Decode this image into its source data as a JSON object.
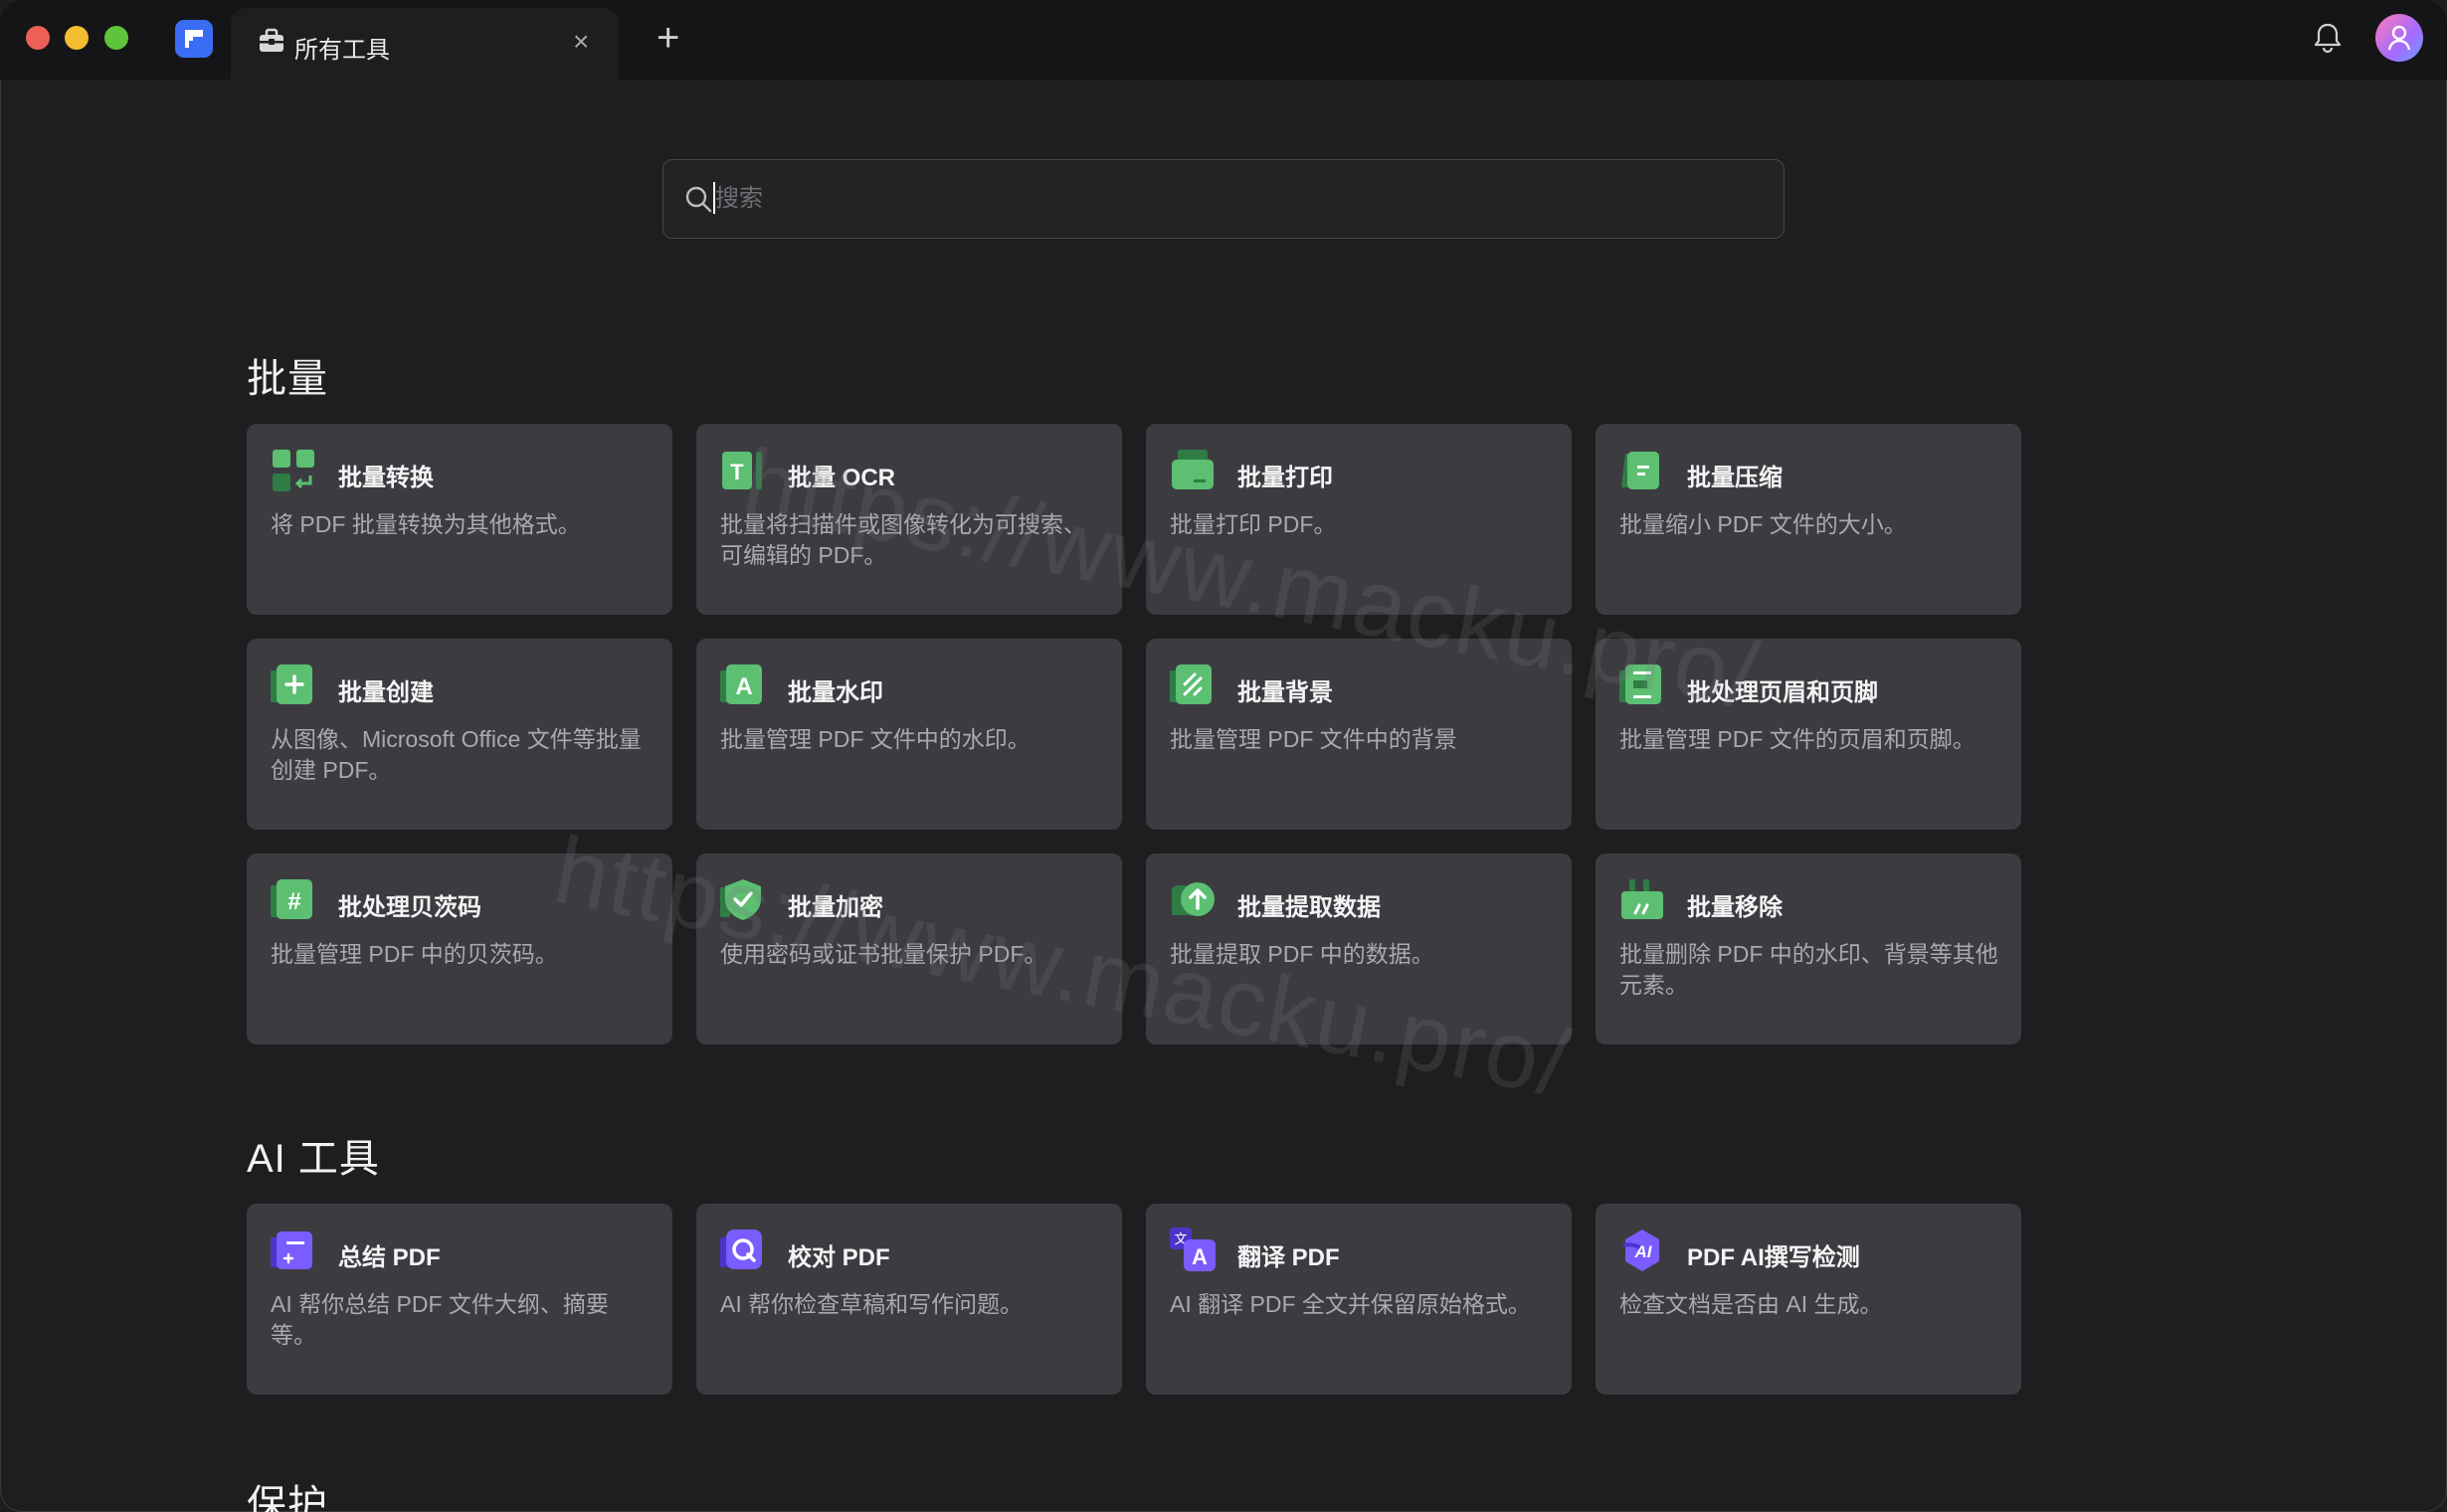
{
  "titlebar": {
    "tab_label": "所有工具",
    "tab_close": "×",
    "new_tab": "+"
  },
  "search": {
    "placeholder": "搜索",
    "value": ""
  },
  "sections": [
    {
      "title": "批量",
      "cards": [
        {
          "title": "批量转换",
          "desc": "将 PDF 批量转换为其他格式。",
          "icon": "batch-convert-icon"
        },
        {
          "title": "批量 OCR",
          "desc": "批量将扫描件或图像转化为可搜索、可编辑的 PDF。",
          "icon": "batch-ocr-icon"
        },
        {
          "title": "批量打印",
          "desc": "批量打印 PDF。",
          "icon": "batch-print-icon"
        },
        {
          "title": "批量压缩",
          "desc": "批量缩小 PDF 文件的大小。",
          "icon": "batch-compress-icon"
        },
        {
          "title": "批量创建",
          "desc": "从图像、Microsoft Office 文件等批量创建 PDF。",
          "icon": "batch-create-icon"
        },
        {
          "title": "批量水印",
          "desc": "批量管理 PDF 文件中的水印。",
          "icon": "batch-watermark-icon"
        },
        {
          "title": "批量背景",
          "desc": "批量管理 PDF 文件中的背景",
          "icon": "batch-background-icon"
        },
        {
          "title": "批处理页眉和页脚",
          "desc": "批量管理 PDF 文件的页眉和页脚。",
          "icon": "batch-header-footer-icon"
        },
        {
          "title": "批处理贝茨码",
          "desc": "批量管理 PDF 中的贝茨码。",
          "icon": "batch-bates-icon"
        },
        {
          "title": "批量加密",
          "desc": "使用密码或证书批量保护 PDF。",
          "icon": "batch-encrypt-icon"
        },
        {
          "title": "批量提取数据",
          "desc": "批量提取 PDF 中的数据。",
          "icon": "batch-extract-icon"
        },
        {
          "title": "批量移除",
          "desc": "批量删除 PDF 中的水印、背景等其他元素。",
          "icon": "batch-remove-icon"
        }
      ]
    },
    {
      "title": "AI 工具",
      "cards": [
        {
          "title": "总结 PDF",
          "desc": "AI 帮你总结 PDF 文件大纲、摘要等。",
          "icon": "summarize-icon"
        },
        {
          "title": "校对 PDF",
          "desc": "AI 帮你检查草稿和写作问题。",
          "icon": "proofread-icon"
        },
        {
          "title": "翻译 PDF",
          "desc": "AI 翻译 PDF 全文并保留原始格式。",
          "icon": "translate-icon"
        },
        {
          "title": "PDF AI撰写检测",
          "desc": "检查文档是否由 AI 生成。",
          "icon": "ai-detect-icon"
        }
      ]
    },
    {
      "title": "保护"
    }
  ],
  "watermark": "https://www.macku.pro/",
  "colors": {
    "batch_icon": "#5cbf72",
    "ai_icon": "#7a5cff",
    "card_bg": "#3c3c40",
    "page_bg": "#1e1e20"
  }
}
